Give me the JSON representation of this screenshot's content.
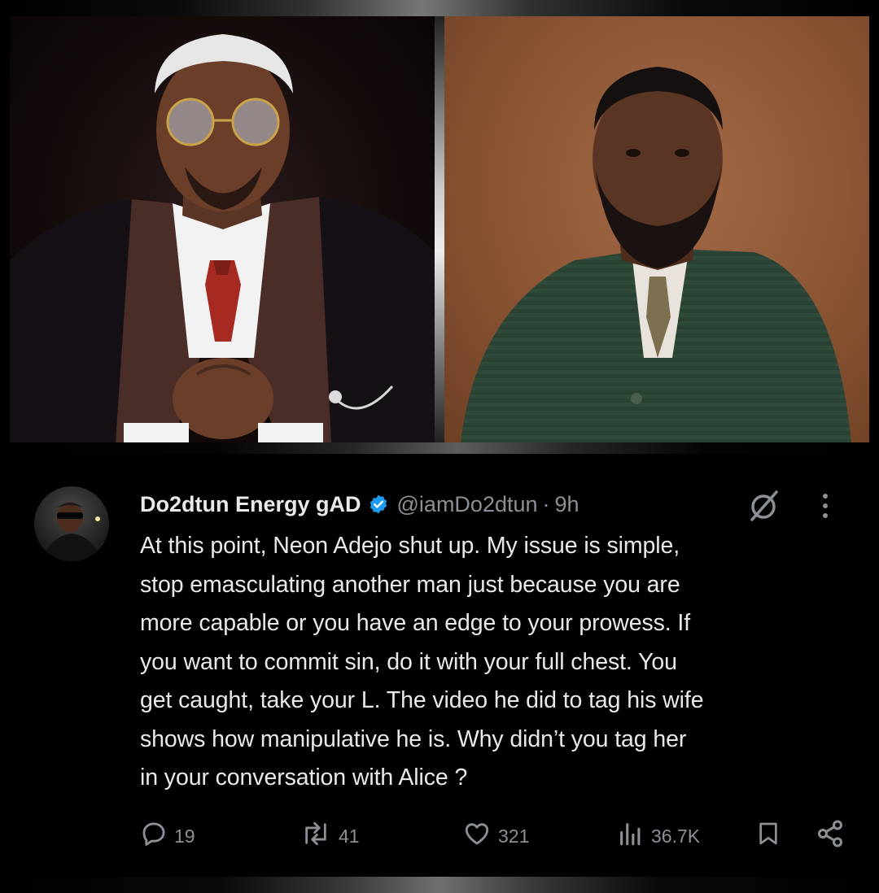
{
  "tweet": {
    "display_name": "Do2dtun Energy gAD",
    "handle": "@iamDo2dtun",
    "separator": "·",
    "time": "9h",
    "verified": true,
    "text": "At this point, Neon Adejo shut up. My issue is simple,\nstop emasculating another man just because you are\nmore capable or you have an edge to your prowess. If\nyou want to commit sin, do it with your full chest. You\nget caught, take your L. The video he did to tag his wife\nshows how manipulative he is. Why didn’t you tag her\nin your conversation with Alice ?",
    "stats": {
      "replies": "19",
      "reposts": "41",
      "likes": "321",
      "views": "36.7K"
    }
  },
  "icons": {
    "verified": "verified-badge-icon",
    "grok": "grok-icon",
    "more": "more-options-icon",
    "reply": "reply-icon",
    "repost": "repost-icon",
    "like": "like-icon",
    "views": "views-icon",
    "bookmark": "bookmark-icon",
    "share": "share-icon"
  },
  "colors": {
    "background": "#000000",
    "text": "#e7e9ea",
    "secondary": "#8b9096",
    "verified_blue": "#1d9bf0"
  }
}
